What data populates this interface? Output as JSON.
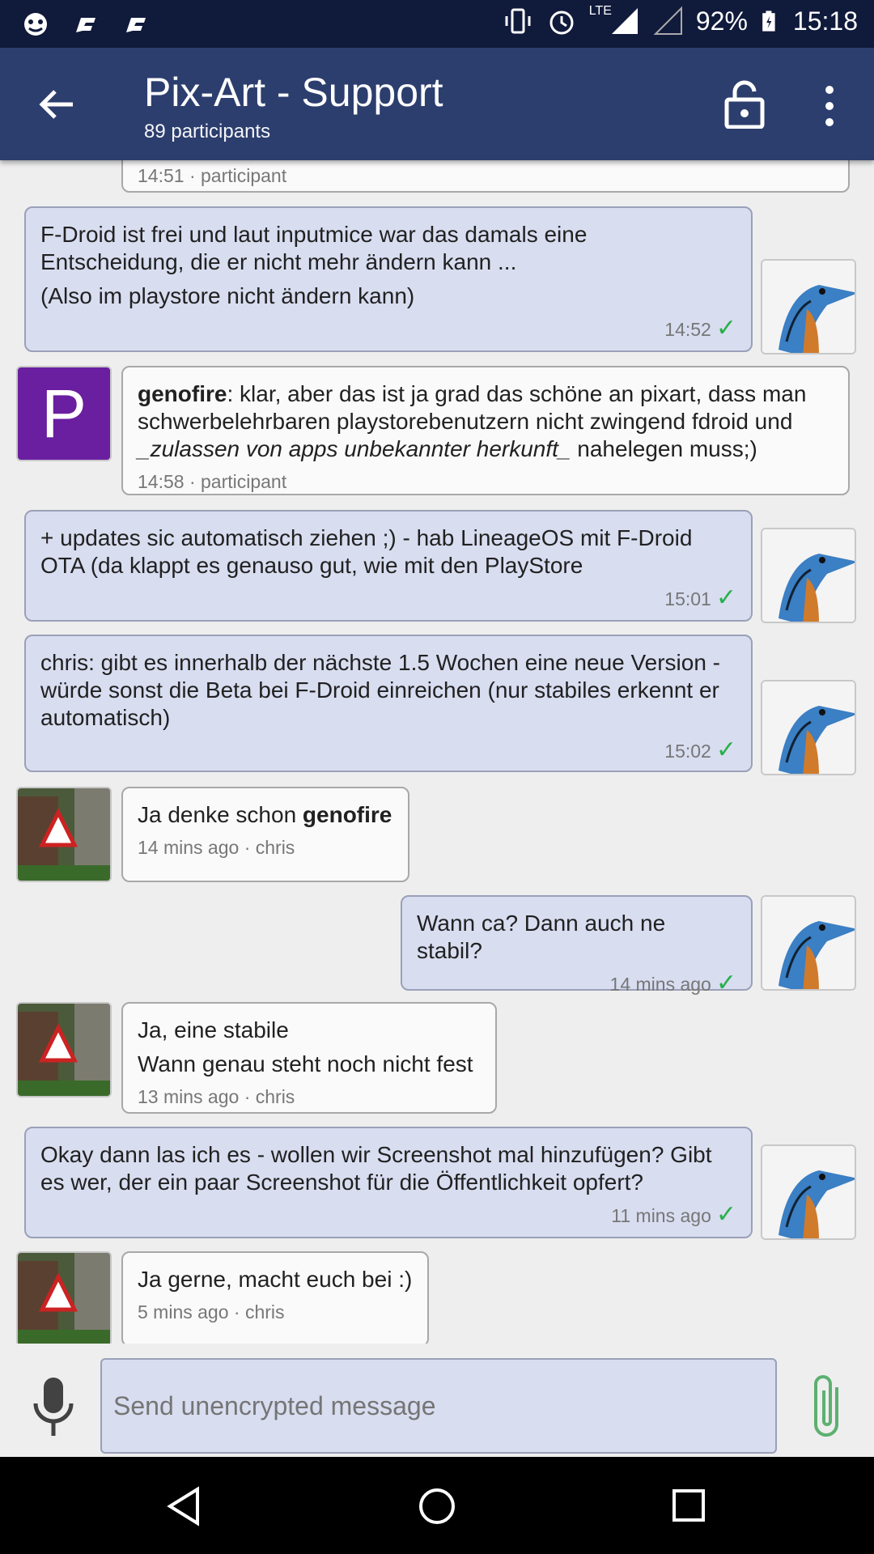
{
  "statusbar": {
    "network": "LTE",
    "battery": "92%",
    "time": "15:18"
  },
  "appbar": {
    "title": "Pix-Art - Support",
    "subtitle": "89 participants"
  },
  "messages": [
    {
      "meta": "14:51 · participant"
    },
    {
      "lines": [
        "F-Droid ist frei und laut inputmice war das damals eine Entscheidung, die er nicht mehr ändern kann ...",
        "(Also im playstore nicht ändern kann)"
      ],
      "time": "14:52"
    },
    {
      "sender": "genofire",
      "text": ": klar, aber das ist ja grad das schöne an pixart, dass man schwerbelehrbaren playstorebenutzern nicht zwingend fdroid und ",
      "italic": "_zulassen von apps unbekannter herkunft_",
      "text2": " nahelegen muss;)",
      "meta": "14:58 · participant",
      "avatar_letter": "P"
    },
    {
      "lines": [
        "+ updates sic automatisch ziehen ;) - hab LineageOS mit F-Droid OTA (da klappt es genauso gut, wie mit den PlayStore"
      ],
      "time": "15:01"
    },
    {
      "lines": [
        "chris: gibt es innerhalb der nächste 1.5 Wochen eine neue Version - würde sonst die Beta bei F-Droid einreichen (nur stabiles erkennt er automatisch)"
      ],
      "time": "15:02"
    },
    {
      "text": "Ja denke schon ",
      "bold": "genofire",
      "meta": "14 mins ago · chris"
    },
    {
      "lines": [
        "Wann ca? Dann auch ne stabil?"
      ],
      "time": "14 mins ago"
    },
    {
      "lines": [
        "Ja, eine stabile",
        "Wann genau steht noch nicht fest"
      ],
      "meta": "13 mins ago · chris"
    },
    {
      "lines": [
        "Okay dann las ich es - wollen wir Screenshot mal hinzufügen? Gibt es wer, der ein paar Screenshot für die Öffentlichkeit opfert?"
      ],
      "time": "11 mins ago"
    },
    {
      "lines": [
        "Ja gerne, macht euch bei :)"
      ],
      "meta": "5 mins ago · chris"
    }
  ],
  "composer": {
    "placeholder": "Send unencrypted message"
  },
  "colors": {
    "statusbar": "#101a3b",
    "appbar": "#2c3e6e",
    "outgoing_bubble": "#d8ddf0",
    "incoming_bubble": "#fafafa",
    "check": "#28b04a",
    "avatar_p": "#6a1ea0"
  }
}
